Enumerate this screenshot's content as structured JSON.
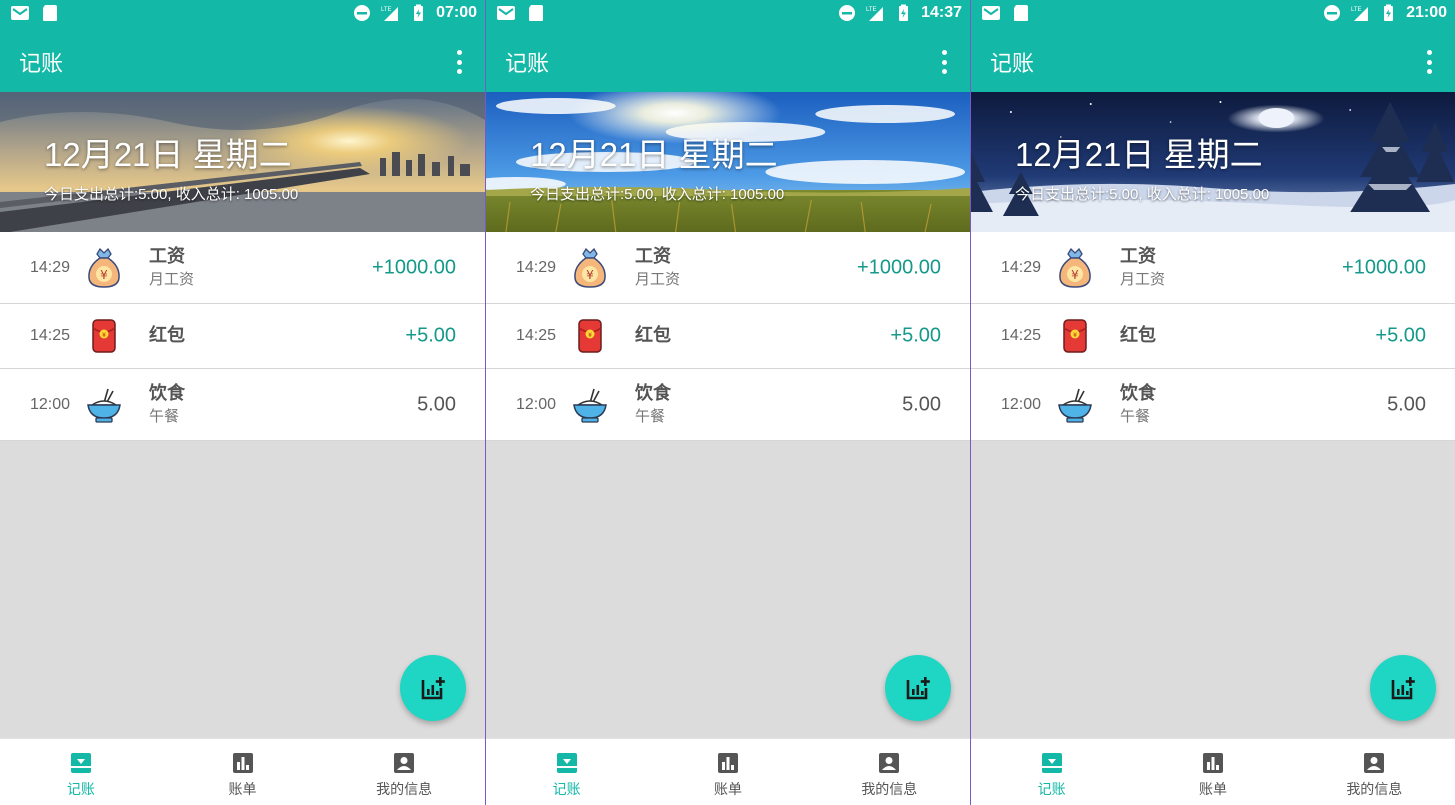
{
  "colors": {
    "primary": "#14b8a6",
    "fab": "#1ed6c3",
    "income": "#14998a"
  },
  "screens": [
    {
      "status": {
        "time": "07:00"
      },
      "appbar": {
        "title": "记账",
        "menu_icon": "more-vert-icon"
      },
      "hero": {
        "scene": "sunset-bridge",
        "date": "12月21日 星期二",
        "summary": "今日支出总计:5.00, 收入总计: 1005.00"
      },
      "records": [
        {
          "time": "14:29",
          "icon": "money-bag-icon",
          "title": "工资",
          "subtitle": "月工资",
          "amount": "+1000.00"
        },
        {
          "time": "14:25",
          "icon": "red-envelope-icon",
          "title": "红包",
          "subtitle": "",
          "amount": "+5.00"
        },
        {
          "time": "12:00",
          "icon": "rice-bowl-icon",
          "title": "饮食",
          "subtitle": "午餐",
          "amount": "5.00"
        }
      ],
      "fab": {
        "icon": "add-chart-icon"
      },
      "nav": [
        {
          "label": "记账",
          "icon": "inbox-download-icon",
          "active": true
        },
        {
          "label": "账单",
          "icon": "bar-chart-icon",
          "active": false
        },
        {
          "label": "我的信息",
          "icon": "account-box-icon",
          "active": false
        }
      ]
    },
    {
      "status": {
        "time": "14:37"
      },
      "appbar": {
        "title": "记账",
        "menu_icon": "more-vert-icon"
      },
      "hero": {
        "scene": "sunny-field",
        "date": "12月21日 星期二",
        "summary": "今日支出总计:5.00, 收入总计: 1005.00"
      },
      "records": [
        {
          "time": "14:29",
          "icon": "money-bag-icon",
          "title": "工资",
          "subtitle": "月工资",
          "amount": "+1000.00"
        },
        {
          "time": "14:25",
          "icon": "red-envelope-icon",
          "title": "红包",
          "subtitle": "",
          "amount": "+5.00"
        },
        {
          "time": "12:00",
          "icon": "rice-bowl-icon",
          "title": "饮食",
          "subtitle": "午餐",
          "amount": "5.00"
        }
      ],
      "fab": {
        "icon": "add-chart-icon"
      },
      "nav": [
        {
          "label": "记账",
          "icon": "inbox-download-icon",
          "active": true
        },
        {
          "label": "账单",
          "icon": "bar-chart-icon",
          "active": false
        },
        {
          "label": "我的信息",
          "icon": "account-box-icon",
          "active": false
        }
      ]
    },
    {
      "status": {
        "time": "21:00"
      },
      "appbar": {
        "title": "记账",
        "menu_icon": "more-vert-icon"
      },
      "hero": {
        "scene": "snowy-night",
        "date": "12月21日 星期二",
        "summary": "今日支出总计:5.00, 收入总计: 1005.00"
      },
      "records": [
        {
          "time": "14:29",
          "icon": "money-bag-icon",
          "title": "工资",
          "subtitle": "月工资",
          "amount": "+1000.00"
        },
        {
          "time": "14:25",
          "icon": "red-envelope-icon",
          "title": "红包",
          "subtitle": "",
          "amount": "+5.00"
        },
        {
          "time": "12:00",
          "icon": "rice-bowl-icon",
          "title": "饮食",
          "subtitle": "午餐",
          "amount": "5.00"
        }
      ],
      "fab": {
        "icon": "add-chart-icon"
      },
      "nav": [
        {
          "label": "记账",
          "icon": "inbox-download-icon",
          "active": true
        },
        {
          "label": "账单",
          "icon": "bar-chart-icon",
          "active": false
        },
        {
          "label": "我的信息",
          "icon": "account-box-icon",
          "active": false
        }
      ]
    }
  ]
}
